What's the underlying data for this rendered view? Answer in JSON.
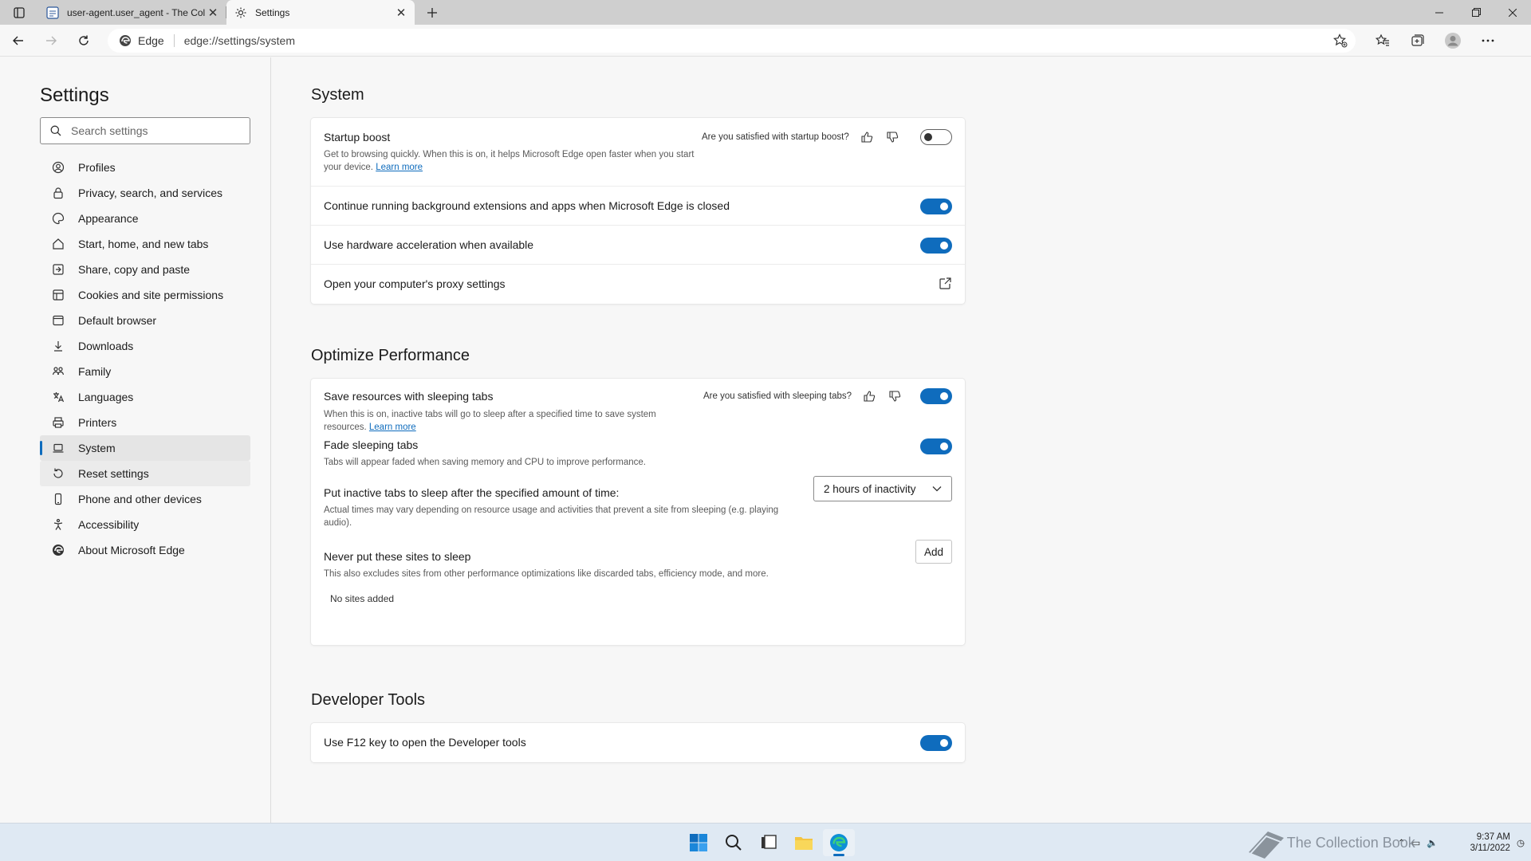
{
  "browser": {
    "tabs": [
      {
        "title": "user-agent.user_agent - The Coll",
        "active": false
      },
      {
        "title": "Settings",
        "active": true
      }
    ],
    "address": {
      "chip": "Edge",
      "url": "edge://settings/system"
    }
  },
  "sidebar": {
    "title": "Settings",
    "search_placeholder": "Search settings",
    "items": [
      {
        "label": "Profiles",
        "icon": "profile-icon"
      },
      {
        "label": "Privacy, search, and services",
        "icon": "lock-icon"
      },
      {
        "label": "Appearance",
        "icon": "appearance-icon"
      },
      {
        "label": "Start, home, and new tabs",
        "icon": "home-icon"
      },
      {
        "label": "Share, copy and paste",
        "icon": "share-icon"
      },
      {
        "label": "Cookies and site permissions",
        "icon": "cookies-icon"
      },
      {
        "label": "Default browser",
        "icon": "browser-icon"
      },
      {
        "label": "Downloads",
        "icon": "download-icon"
      },
      {
        "label": "Family",
        "icon": "family-icon"
      },
      {
        "label": "Languages",
        "icon": "language-icon"
      },
      {
        "label": "Printers",
        "icon": "printer-icon"
      },
      {
        "label": "System",
        "icon": "laptop-icon"
      },
      {
        "label": "Reset settings",
        "icon": "reset-icon"
      },
      {
        "label": "Phone and other devices",
        "icon": "phone-icon"
      },
      {
        "label": "Accessibility",
        "icon": "accessibility-icon"
      },
      {
        "label": "About Microsoft Edge",
        "icon": "edge-icon"
      }
    ]
  },
  "system": {
    "title": "System",
    "startup_boost": {
      "title": "Startup boost",
      "desc": "Get to browsing quickly. When this is on, it helps Microsoft Edge open faster when you start your device.",
      "learn_more": "Learn more",
      "feedback": "Are you satisfied with startup boost?",
      "enabled": false
    },
    "background_ext": {
      "title": "Continue running background extensions and apps when Microsoft Edge is closed",
      "enabled": true
    },
    "hw_accel": {
      "title": "Use hardware acceleration when available",
      "enabled": true
    },
    "proxy": {
      "title": "Open your computer's proxy settings"
    }
  },
  "performance": {
    "title": "Optimize Performance",
    "sleeping_tabs": {
      "title": "Save resources with sleeping tabs",
      "desc": "When this is on, inactive tabs will go to sleep after a specified time to save system resources.",
      "learn_more": "Learn more",
      "feedback": "Are you satisfied with sleeping tabs?",
      "enabled": true
    },
    "fade_tabs": {
      "title": "Fade sleeping tabs",
      "desc": "Tabs will appear faded when saving memory and CPU to improve performance.",
      "enabled": true
    },
    "inactive_sleep": {
      "title": "Put inactive tabs to sleep after the specified amount of time:",
      "desc": "Actual times may vary depending on resource usage and activities that prevent a site from sleeping (e.g. playing audio).",
      "selected": "2 hours of inactivity"
    },
    "never_sleep": {
      "title": "Never put these sites to sleep",
      "desc": "This also excludes sites from other performance optimizations like discarded tabs, efficiency mode, and more.",
      "add_label": "Add",
      "empty": "No sites added"
    }
  },
  "developer": {
    "title": "Developer Tools",
    "f12": {
      "title": "Use F12 key to open the Developer tools",
      "enabled": true
    }
  },
  "taskbar": {
    "watermark": "The Collection Book",
    "time": "9:37 AM",
    "date": "3/11/2022"
  },
  "colors": {
    "accent": "#0f6cbd",
    "taskbar": "#dfe9f3"
  }
}
